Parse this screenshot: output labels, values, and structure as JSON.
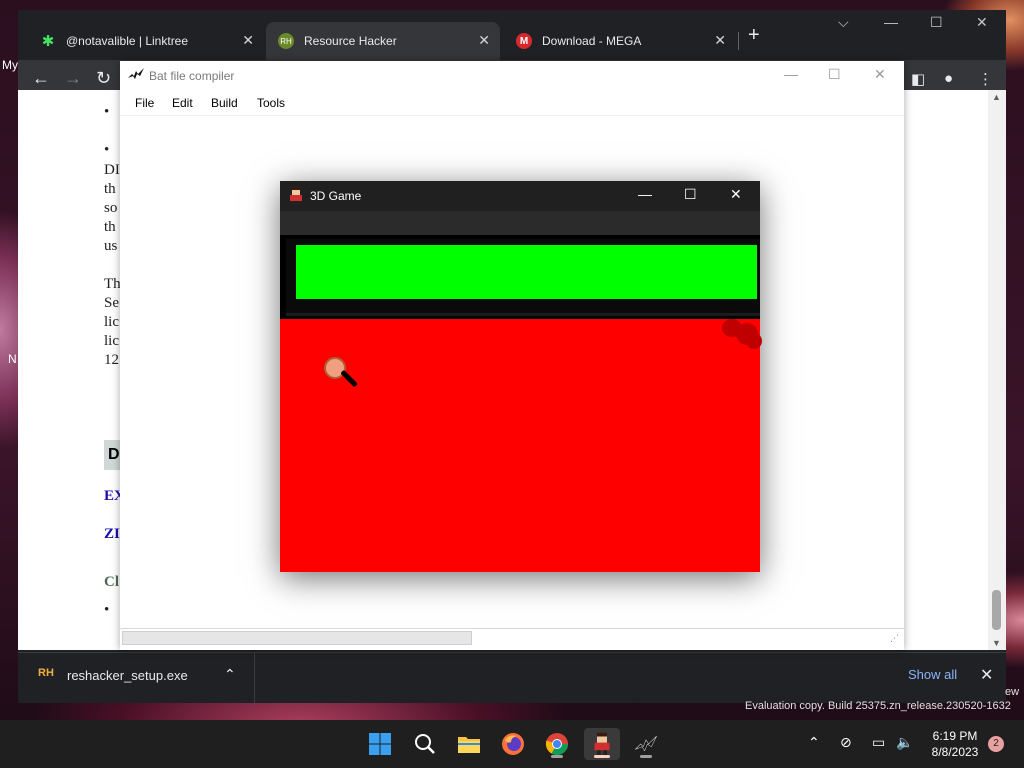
{
  "desktop": {
    "left_text_my": "My",
    "left_text_n": "N"
  },
  "browser": {
    "tabs": [
      {
        "title": "@notavalible | Linktree",
        "icon": "linktree-icon",
        "active": false
      },
      {
        "title": "Resource Hacker",
        "icon": "resource-hacker-icon",
        "active": true
      },
      {
        "title": "Download - MEGA",
        "icon": "mega-icon",
        "active": false
      }
    ],
    "new_tab_symbol": "+",
    "downloads": {
      "file_name": "reshacker_setup.exe",
      "file_icon_text": "RH",
      "show_all": "Show all"
    },
    "page": {
      "bullet1": "•",
      "bullet2": "•",
      "lines_block1": [
        "DI",
        "th",
        "so",
        "th",
        "us"
      ],
      "lines_block2": [
        "Th",
        "Se",
        "lic",
        "lic",
        "12"
      ],
      "boxed_letter": "D",
      "link1": "EX",
      "link2": "ZI",
      "gray_text": "Cl",
      "bullet3": "•"
    }
  },
  "bat_window": {
    "title": "Bat file compiler",
    "menu": [
      "File",
      "Edit",
      "Build",
      "Tools"
    ]
  },
  "game_window": {
    "title": "3D Game",
    "health_color": "#00ff00",
    "arena_color": "#ff0000"
  },
  "taskbar": {
    "watermark": "Evaluation copy. Build 25375.zn_release.230520-1632",
    "watermark_fragment": "ew",
    "time": "6:19 PM",
    "date": "8/8/2023",
    "notification_count": "2"
  }
}
